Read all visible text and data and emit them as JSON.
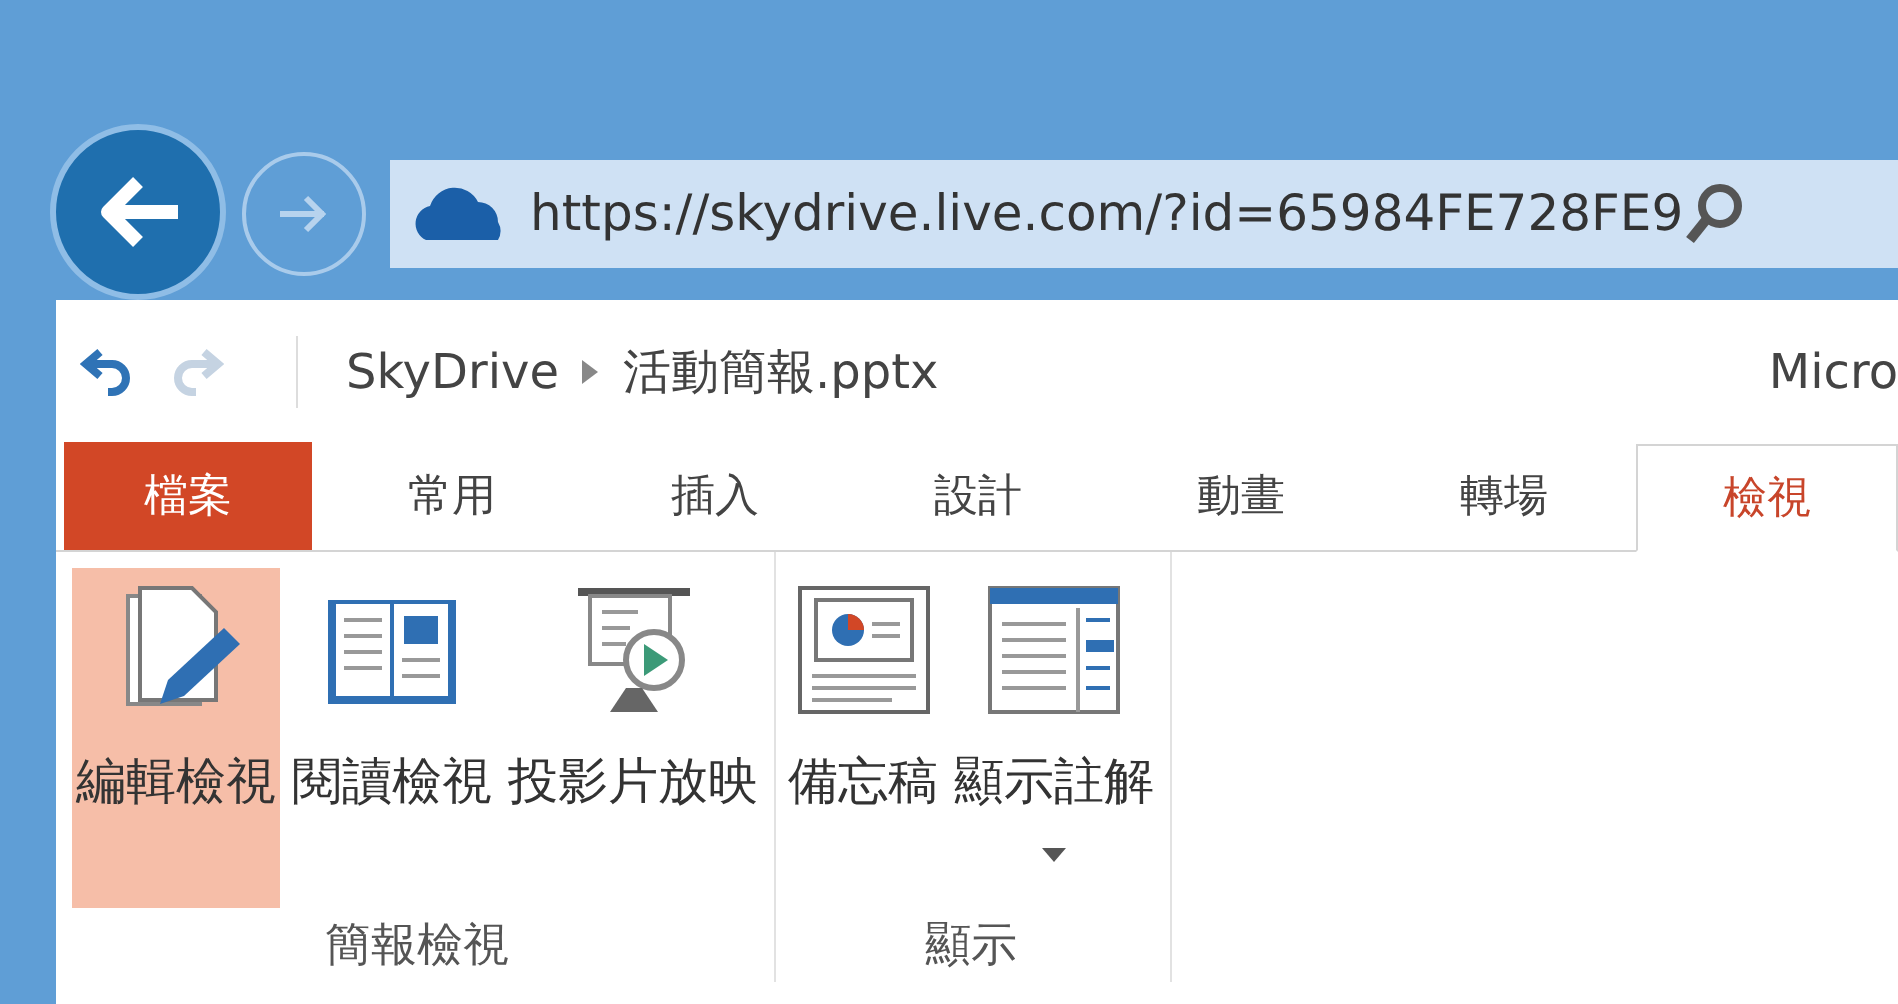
{
  "browser": {
    "address": "https://skydrive.live.com/?id=65984FE728FE9"
  },
  "quick_access": [
    {
      "kind": "undo",
      "disabled": false
    },
    {
      "kind": "redo",
      "disabled": true
    }
  ],
  "breadcrumb": {
    "items": [
      "SkyDrive",
      "活動簡報.pptx"
    ],
    "app_title": "Micro"
  },
  "tabs": [
    {
      "label": "檔案",
      "kind": "file",
      "selected": false
    },
    {
      "label": "常用",
      "kind": "tab",
      "selected": false
    },
    {
      "label": "插入",
      "kind": "tab",
      "selected": false
    },
    {
      "label": "設計",
      "kind": "tab",
      "selected": false
    },
    {
      "label": "動畫",
      "kind": "tab",
      "selected": false
    },
    {
      "label": "轉場",
      "kind": "tab",
      "selected": false
    },
    {
      "label": "檢視",
      "kind": "tab",
      "selected": true
    }
  ],
  "groups": [
    {
      "label": "簡報檢視",
      "buttons": [
        {
          "label": "編輯檢視",
          "kind": "edit",
          "selected": true,
          "dropdown": false
        },
        {
          "label": "閱讀檢視",
          "kind": "reading",
          "selected": false,
          "dropdown": false
        },
        {
          "label": "投影片放映",
          "kind": "slideshow",
          "selected": false,
          "dropdown": false
        }
      ]
    },
    {
      "label": "顯示",
      "buttons": [
        {
          "label": "備忘稿",
          "kind": "notes",
          "selected": false,
          "dropdown": false
        },
        {
          "label": "顯示註解",
          "kind": "comments",
          "selected": false,
          "dropdown": true
        }
      ]
    }
  ]
}
